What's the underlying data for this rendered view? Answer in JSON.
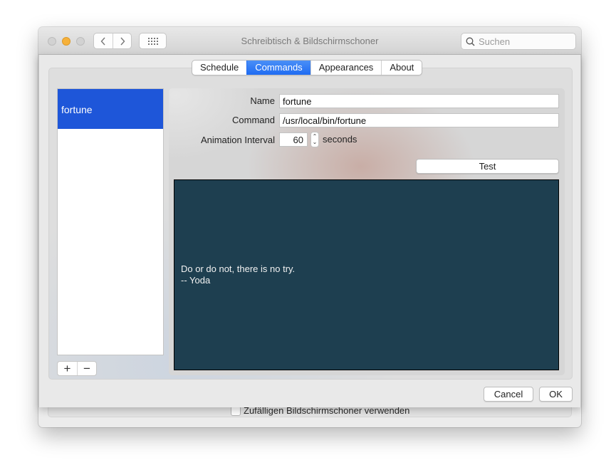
{
  "window": {
    "title": "Schreibtisch & Bildschirmschoner",
    "search_placeholder": "Suchen",
    "nav": {
      "back_icon": "chevron-left-icon",
      "forward_icon": "chevron-right-icon",
      "grid_icon": "show-all-grid-icon"
    },
    "random_screensaver_label": "Zufälligen Bildschirmschoner verwenden",
    "random_screensaver_checked": false
  },
  "sheet": {
    "tabs": [
      {
        "label": "Schedule",
        "active": false
      },
      {
        "label": "Commands",
        "active": true
      },
      {
        "label": "Appearances",
        "active": false
      },
      {
        "label": "About",
        "active": false
      }
    ],
    "commands_list": [
      {
        "label": "fortune",
        "selected": true
      }
    ],
    "list_controls": {
      "add": "+",
      "remove": "−"
    },
    "form": {
      "name_label": "Name",
      "name_value": "fortune",
      "command_label": "Command",
      "command_value": "/usr/local/bin/fortune",
      "interval_label": "Animation Interval",
      "interval_value": "60",
      "interval_unit": "seconds",
      "test_button": "Test"
    },
    "preview": {
      "text": "Do or do not, there is no try.\n-- Yoda",
      "background": "#1e3f50"
    },
    "buttons": {
      "cancel": "Cancel",
      "ok": "OK"
    }
  },
  "colors": {
    "accent": "#1f6cf2",
    "selection": "#1e56d9",
    "traffic_minimize": "#f6b13a"
  }
}
